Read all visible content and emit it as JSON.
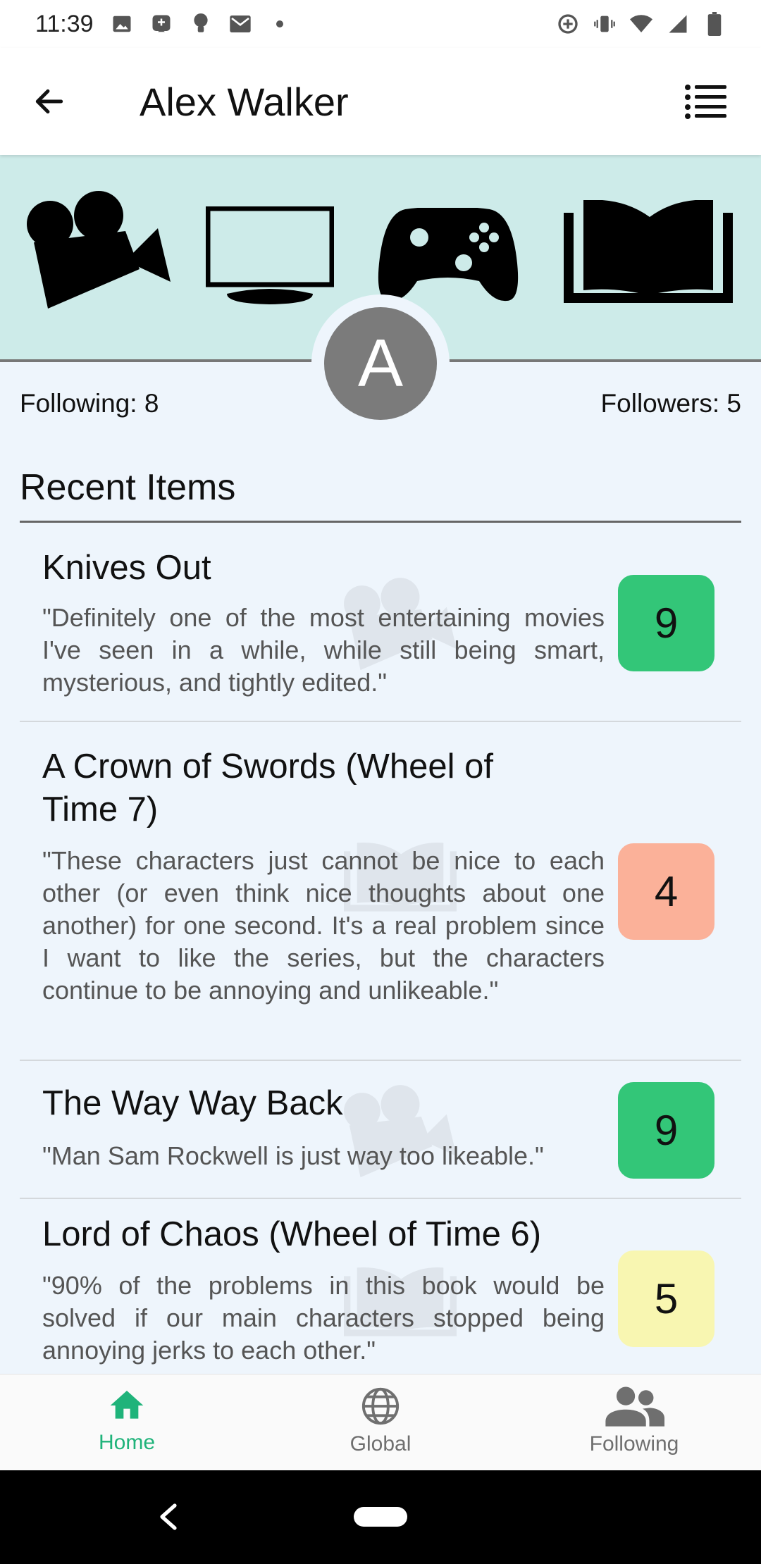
{
  "status_bar": {
    "time": "11:39"
  },
  "header": {
    "title": "Alex Walker"
  },
  "profile": {
    "avatar_letter": "A",
    "following_text": "Following: 8",
    "followers_text": "Followers: 5"
  },
  "section": {
    "title": "Recent Items"
  },
  "items": [
    {
      "title": "Knives Out",
      "review": "\"Definitely one of the most entertaining movies I've seen in a while, while still being smart, mysterious, and tightly edited.\"",
      "score": "9",
      "category": "movie",
      "score_color": "#33c678"
    },
    {
      "title": "A Crown of Swords (Wheel of Time 7)",
      "review": "\"These characters just cannot be nice to each other (or even think nice thoughts about one another) for one second. It's a real problem since I want to like the series, but the characters continue to be annoying and unlikeable.\"",
      "score": "4",
      "category": "book",
      "score_color": "#fbb199"
    },
    {
      "title": "The Way Way Back",
      "review": "\"Man Sam Rockwell is just way too likeable.\"",
      "score": "9",
      "category": "movie",
      "score_color": "#33c678"
    },
    {
      "title": "Lord of Chaos (Wheel of Time 6)",
      "review": "\"90% of the problems in this book would be solved if our main characters stopped being annoying jerks to each other.\"",
      "score": "5",
      "category": "book",
      "score_color": "#f8f6b1"
    }
  ],
  "bottom_nav": {
    "items": [
      {
        "label": "Home",
        "icon": "home-icon",
        "active": true
      },
      {
        "label": "Global",
        "icon": "globe-icon",
        "active": false
      },
      {
        "label": "Following",
        "icon": "people-icon",
        "active": false
      }
    ],
    "active_color": "#1fb37a",
    "inactive_color": "#6f6f6f"
  }
}
